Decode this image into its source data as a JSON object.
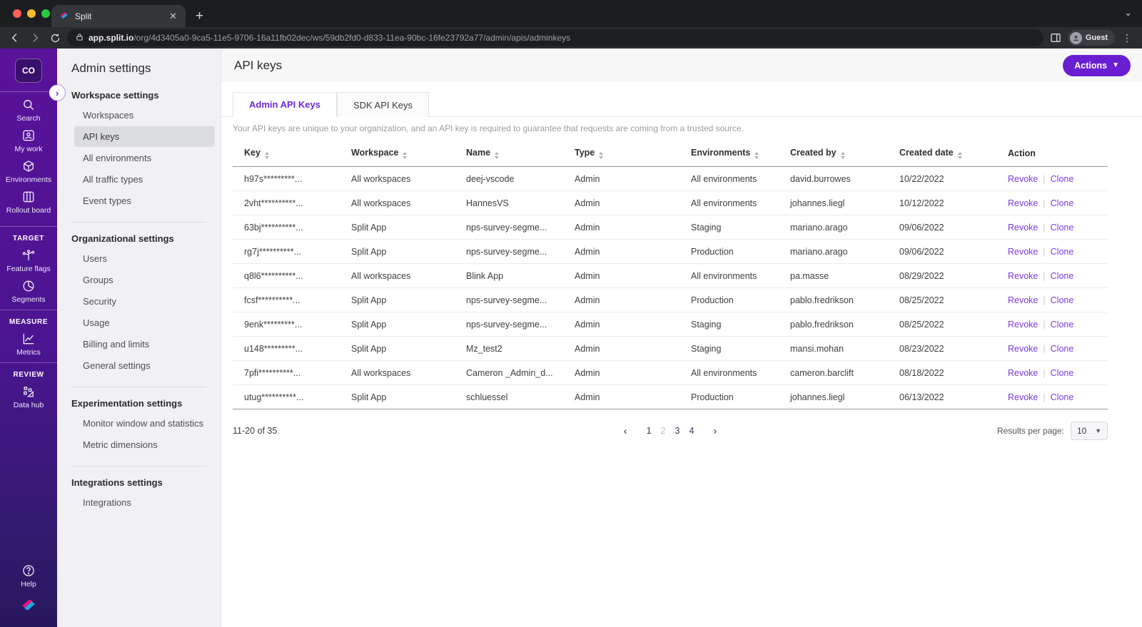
{
  "browser": {
    "tab_title": "Split",
    "url_host": "app.split.io",
    "url_path": "/org/4d3405a0-9ca5-11e5-9706-16a11fb02dec/ws/59db2fd0-d833-11ea-90bc-16fe23792a77/admin/apis/adminkeys",
    "profile_label": "Guest"
  },
  "sidebar": {
    "logo_text": "CO",
    "primary": [
      {
        "label": "Search",
        "icon": "search-icon"
      },
      {
        "label": "My work",
        "icon": "my-work-icon"
      },
      {
        "label": "Environments",
        "icon": "environments-icon"
      },
      {
        "label": "Rollout board",
        "icon": "rollout-board-icon"
      }
    ],
    "sections": [
      {
        "label": "TARGET",
        "items": [
          {
            "label": "Feature flags",
            "icon": "feature-flags-icon"
          },
          {
            "label": "Segments",
            "icon": "segments-icon"
          }
        ]
      },
      {
        "label": "MEASURE",
        "items": [
          {
            "label": "Metrics",
            "icon": "metrics-icon"
          }
        ]
      },
      {
        "label": "REVIEW",
        "items": [
          {
            "label": "Data hub",
            "icon": "data-hub-icon"
          }
        ]
      }
    ],
    "help_label": "Help"
  },
  "nav": {
    "title": "Admin settings",
    "active_item": "API keys",
    "groups": [
      {
        "label": "Workspace settings",
        "items": [
          "Workspaces",
          "API keys",
          "All environments",
          "All traffic types",
          "Event types"
        ]
      },
      {
        "label": "Organizational settings",
        "items": [
          "Users",
          "Groups",
          "Security",
          "Usage",
          "Billing and limits",
          "General settings"
        ]
      },
      {
        "label": "Experimentation settings",
        "items": [
          "Monitor window and statistics",
          "Metric dimensions"
        ]
      },
      {
        "label": "Integrations settings",
        "items": [
          "Integrations"
        ]
      }
    ]
  },
  "main": {
    "page_title": "API keys",
    "actions_label": "Actions",
    "tabs": [
      {
        "label": "Admin API Keys",
        "active": true
      },
      {
        "label": "SDK API Keys",
        "active": false
      }
    ],
    "description": "Your API keys are unique to your organization, and an API key is required to guarantee that requests are coming from a trusted source.",
    "table": {
      "columns": [
        {
          "label": "Key",
          "sortable": true
        },
        {
          "label": "Workspace",
          "sortable": true
        },
        {
          "label": "Name",
          "sortable": true
        },
        {
          "label": "Type",
          "sortable": true
        },
        {
          "label": "Environments",
          "sortable": true
        },
        {
          "label": "Created by",
          "sortable": true
        },
        {
          "label": "Created date",
          "sortable": true
        },
        {
          "label": "Action",
          "sortable": false
        }
      ],
      "rows": [
        {
          "key": "h97s*********...",
          "workspace": "All workspaces",
          "name": "deej-vscode",
          "type": "Admin",
          "environments": "All environments",
          "created_by": "david.burrowes",
          "created_date": "10/22/2022"
        },
        {
          "key": "2vht**********...",
          "workspace": "All workspaces",
          "name": "HannesVS",
          "type": "Admin",
          "environments": "All environments",
          "created_by": "johannes.liegl",
          "created_date": "10/12/2022"
        },
        {
          "key": "63bj**********...",
          "workspace": "Split App",
          "name": "nps-survey-segme...",
          "type": "Admin",
          "environments": "Staging",
          "created_by": "mariano.arago",
          "created_date": "09/06/2022"
        },
        {
          "key": "rg7j**********...",
          "workspace": "Split App",
          "name": "nps-survey-segme...",
          "type": "Admin",
          "environments": "Production",
          "created_by": "mariano.arago",
          "created_date": "09/06/2022"
        },
        {
          "key": "q8l6**********...",
          "workspace": "All workspaces",
          "name": "Blink App",
          "type": "Admin",
          "environments": "All environments",
          "created_by": "pa.masse",
          "created_date": "08/29/2022"
        },
        {
          "key": "fcsf**********...",
          "workspace": "Split App",
          "name": "nps-survey-segme...",
          "type": "Admin",
          "environments": "Production",
          "created_by": "pablo.fredrikson",
          "created_date": "08/25/2022"
        },
        {
          "key": "9enk*********...",
          "workspace": "Split App",
          "name": "nps-survey-segme...",
          "type": "Admin",
          "environments": "Staging",
          "created_by": "pablo.fredrikson",
          "created_date": "08/25/2022"
        },
        {
          "key": "u148*********...",
          "workspace": "Split App",
          "name": "Mz_test2",
          "type": "Admin",
          "environments": "Staging",
          "created_by": "mansi.mohan",
          "created_date": "08/23/2022"
        },
        {
          "key": "7pfi**********...",
          "workspace": "All workspaces",
          "name": "Cameron _Admin_d...",
          "type": "Admin",
          "environments": "All environments",
          "created_by": "cameron.barclift",
          "created_date": "08/18/2022"
        },
        {
          "key": "utug**********...",
          "workspace": "Split App",
          "name": "schluessel",
          "type": "Admin",
          "environments": "Production",
          "created_by": "johannes.liegl",
          "created_date": "06/13/2022"
        }
      ]
    },
    "row_actions": {
      "revoke": "Revoke",
      "clone": "Clone"
    },
    "pagination": {
      "range_text": "11-20 of 35",
      "pages": [
        "1",
        "2",
        "3",
        "4"
      ],
      "current_page": "2",
      "results_per_page_label": "Results per page:",
      "results_per_page_value": "10"
    }
  },
  "colors": {
    "accent_purple": "#6A1ED2",
    "link_purple": "#7C3AE8",
    "sidebar_top": "#5A129A",
    "sidebar_bottom": "#27175E",
    "brand_magenta": "#E6127D",
    "brand_blue": "#19A9E5"
  }
}
